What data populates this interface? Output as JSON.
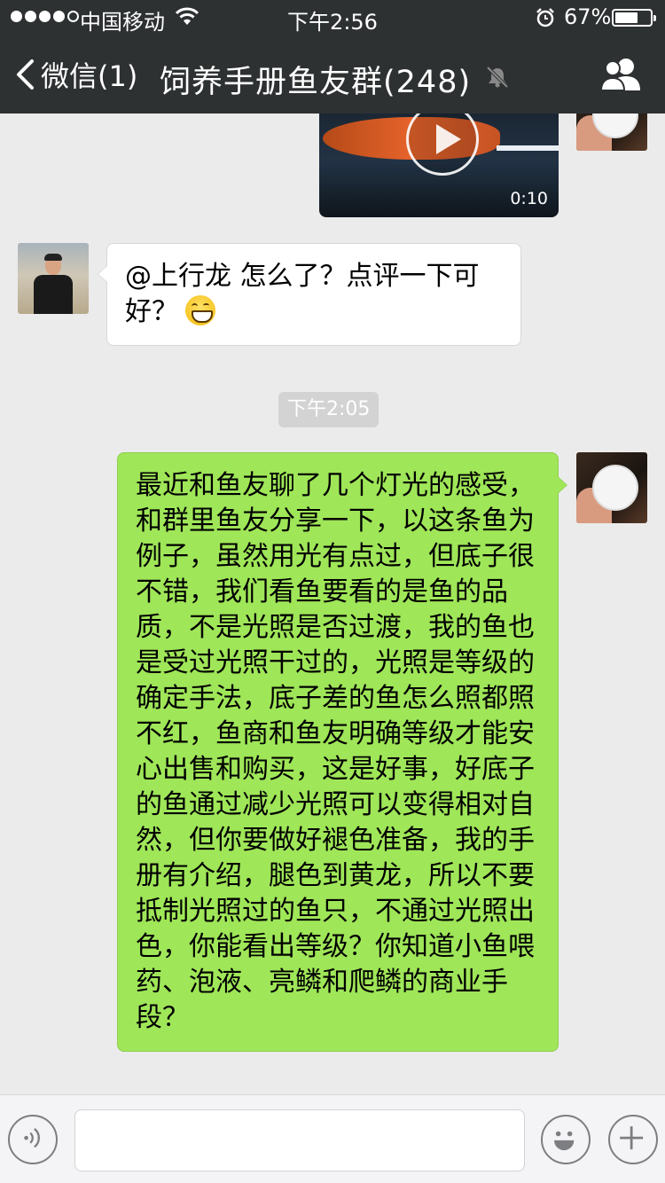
{
  "status_bar": {
    "carrier": "中国移动",
    "time": "下午2:56",
    "battery_percent_text": "67%",
    "battery_level": 0.67,
    "signal_bars_filled": 4,
    "signal_bars_total": 5
  },
  "nav": {
    "back_label": "微信(1)",
    "title": "饲养手册鱼友群(248)",
    "icons": [
      "chevron-left-icon",
      "mute-icon",
      "group-members-icon"
    ]
  },
  "messages": [
    {
      "type": "video",
      "side": "right",
      "duration": "0:10"
    },
    {
      "type": "text",
      "side": "left",
      "text": "@上行龙 怎么了？点评一下可好？",
      "emoji": "grinning-face"
    },
    {
      "type": "timestamp",
      "text": "下午2:05"
    },
    {
      "type": "text",
      "side": "right",
      "text": "最近和鱼友聊了几个灯光的感受，和群里鱼友分享一下，以这条鱼为例子，虽然用光有点过，但底子很不错，我们看鱼要看的是鱼的品质，不是光照是否过渡，我的鱼也是受过光照干过的，光照是等级的确定手法，底子差的鱼怎么照都照不红，鱼商和鱼友明确等级才能安心出售和购买，这是好事，好底子的鱼通过减少光照可以变得相对自然，但你要做好褪色准备，我的手册有介绍，腿色到黄龙，所以不要抵制光照过的鱼只，不通过光照出色，你能看出等级？你知道小鱼喂药、泡液、亮鳞和爬鳞的商业手段？"
    }
  ],
  "input_bar": {
    "value": "",
    "icons": [
      "voice-icon",
      "emoji-icon",
      "plus-icon"
    ]
  },
  "colors": {
    "header_bg": "#2e3132",
    "chat_bg": "#ebebeb",
    "bubble_right": "#9fe658",
    "bubble_left": "#ffffff"
  }
}
